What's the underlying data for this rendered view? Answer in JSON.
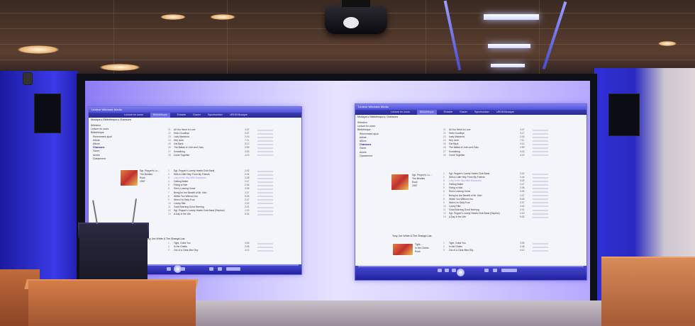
{
  "scene": {
    "colors": {
      "wall_light": "#3a3ae8",
      "screen_glow": "#c9c2ff",
      "desk_wood": "#d47d48",
      "ceiling": "#5a3f30"
    }
  },
  "left_window": {
    "title": "Lecteur Windows Media",
    "tabs": [
      "Lecture en cours",
      "Bibliothèque",
      "Extraire",
      "Graver",
      "Synchroniser",
      "URGE/Musique"
    ],
    "active_tab_index": 1,
    "breadcrumb": "Musique ▸ Bibliothèque ▸ Chansons",
    "nav": [
      "Sélection",
      "Lecture en cours",
      "Bibliothèque",
      "Récemment ajout",
      "Artiste",
      "Album",
      "Chansons",
      "Genre",
      "Année",
      "Classement"
    ],
    "nav_selected_index": 6,
    "album_info": [
      "Sgt. Pepper's Lo...",
      "The Beatles",
      "Rock",
      "1967"
    ],
    "tracks_top": [
      {
        "num": "21",
        "name": "All You Need Is Love",
        "dur": "3:47"
      },
      {
        "num": "22",
        "name": "Hello Goodbye",
        "dur": "3:27"
      },
      {
        "num": "23",
        "name": "Lady Madonna",
        "dur": "2:16"
      },
      {
        "num": "24",
        "name": "Hey Jude",
        "dur": "7:11"
      },
      {
        "num": "25",
        "name": "Get Back",
        "dur": "3:12"
      },
      {
        "num": "26",
        "name": "The Ballad of John and Yoko",
        "dur": "2:59"
      },
      {
        "num": "27",
        "name": "Something",
        "dur": "3:03"
      },
      {
        "num": "28",
        "name": "Come Together",
        "dur": "4:19"
      }
    ],
    "tracks_album": [
      {
        "num": "1",
        "name": "Sgt. Pepper's Lonely Hearts Club Band",
        "dur": "2:02"
      },
      {
        "num": "2",
        "name": "With a Little Help From My Friends",
        "dur": "2:44"
      },
      {
        "num": "3",
        "name": "Lucy in the Sky With Diamonds",
        "dur": "3:28",
        "dim": true
      },
      {
        "num": "4",
        "name": "Getting Better",
        "dur": "2:47"
      },
      {
        "num": "5",
        "name": "Fixing a Hole",
        "dur": "2:36"
      },
      {
        "num": "6",
        "name": "She's Leaving Home",
        "dur": "3:35"
      },
      {
        "num": "7",
        "name": "Being for the Benefit of Mr. Kite!",
        "dur": "2:37"
      },
      {
        "num": "8",
        "name": "Within You Without You",
        "dur": "5:05"
      },
      {
        "num": "9",
        "name": "When I'm Sixty-Four",
        "dur": "2:37"
      },
      {
        "num": "10",
        "name": "Lovely Rita",
        "dur": "2:42"
      },
      {
        "num": "11",
        "name": "Good Morning Good Morning",
        "dur": "2:41"
      },
      {
        "num": "12",
        "name": "Sgt. Pepper's Lonely Hearts Club Band (Reprise)",
        "dur": "1:19"
      },
      {
        "num": "13",
        "name": "A Day in the Life",
        "dur": "5:33"
      }
    ],
    "album2_title": "Tony Joe White & The Shangri-Las",
    "tracks_album2": [
      {
        "num": "1",
        "name": "Tight, Gotta You",
        "dur": "3:05"
      },
      {
        "num": "2",
        "name": "In the Ghetto",
        "dur": "2:48"
      },
      {
        "num": "3",
        "name": "Out of a Clear Blue Sky",
        "dur": "4:12"
      }
    ]
  },
  "right_window": {
    "title": "Lecteur Windows Media",
    "tabs": [
      "Lecture en cours",
      "Bibliothèque",
      "Extraire",
      "Graver",
      "Synchroniser",
      "URGE/Musique"
    ],
    "active_tab_index": 1,
    "breadcrumb": "Musique ▸ Bibliothèque ▸ Chansons",
    "nav": [
      "Sélection",
      "Lecture en cours",
      "Bibliothèque",
      "Récemment ajout",
      "Artiste",
      "Album",
      "Chansons",
      "Genre",
      "Année",
      "Classement"
    ],
    "nav_selected_index": 6,
    "album_info": [
      "Sgt. Pepper's Lo...",
      "The Beatles",
      "Rock",
      "1967"
    ],
    "album2_title": "Tony Joe White & The Shangri-Las",
    "album2_info": [
      "Tight, ...",
      "In the Ghetto",
      "Rock"
    ]
  }
}
